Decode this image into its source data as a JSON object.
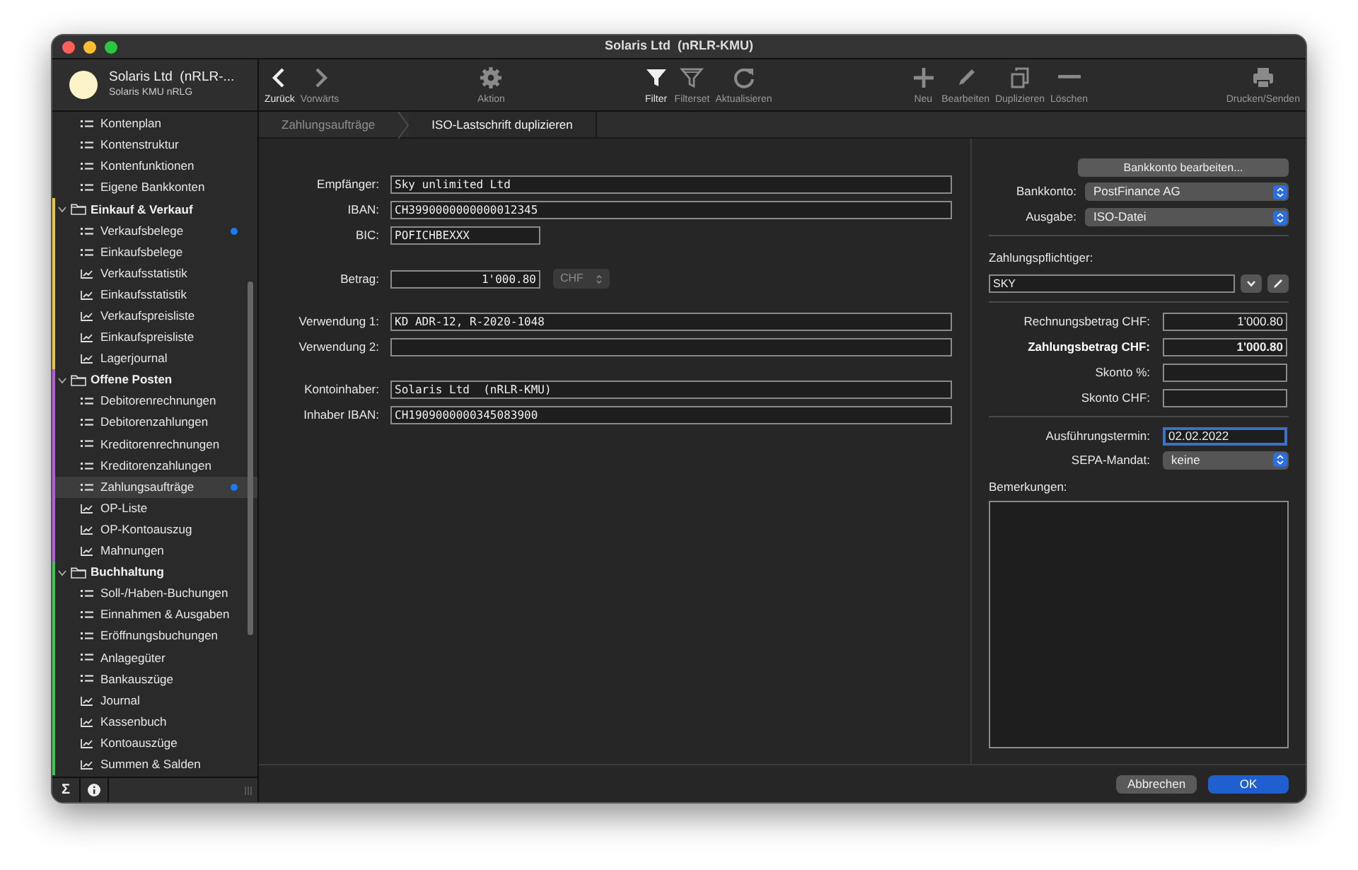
{
  "window": {
    "title": "Solaris Ltd  (nRLR-KMU)"
  },
  "sidebar": {
    "header": {
      "title": "Solaris Ltd  (nRLR-...",
      "subtitle": "Solaris KMU nRLG"
    },
    "partial_items": [
      {
        "label": "Kontenplan",
        "kind": "list",
        "selected": false,
        "unread": false
      },
      {
        "label": "Kontenstruktur",
        "kind": "list",
        "selected": false,
        "unread": false
      },
      {
        "label": "Kontenfunktionen",
        "kind": "list",
        "selected": false,
        "unread": false
      },
      {
        "label": "Eigene Bankkonten",
        "kind": "list",
        "selected": false,
        "unread": false
      }
    ],
    "groups": [
      {
        "label": "Einkauf & Verkauf",
        "color": "#e6c83a",
        "expanded": true,
        "children": [
          {
            "label": "Verkaufsbelege",
            "kind": "list",
            "selected": false,
            "unread": true
          },
          {
            "label": "Einkaufsbelege",
            "kind": "list",
            "selected": false,
            "unread": false
          },
          {
            "label": "Verkaufsstatistik",
            "kind": "report",
            "selected": false,
            "unread": false
          },
          {
            "label": "Einkaufsstatistik",
            "kind": "report",
            "selected": false,
            "unread": false
          },
          {
            "label": "Verkaufspreisliste",
            "kind": "report",
            "selected": false,
            "unread": false
          },
          {
            "label": "Einkaufspreisliste",
            "kind": "report",
            "selected": false,
            "unread": false
          },
          {
            "label": "Lagerjournal",
            "kind": "report",
            "selected": false,
            "unread": false
          }
        ]
      },
      {
        "label": "Offene Posten",
        "color": "#b45cd6",
        "expanded": true,
        "children": [
          {
            "label": "Debitorenrechnungen",
            "kind": "list",
            "selected": false,
            "unread": false
          },
          {
            "label": "Debitorenzahlungen",
            "kind": "list",
            "selected": false,
            "unread": false
          },
          {
            "label": "Kreditorenrechnungen",
            "kind": "list",
            "selected": false,
            "unread": false
          },
          {
            "label": "Kreditorenzahlungen",
            "kind": "list",
            "selected": false,
            "unread": false
          },
          {
            "label": "Zahlungsaufträge",
            "kind": "list",
            "selected": true,
            "unread": true
          },
          {
            "label": "OP-Liste",
            "kind": "report",
            "selected": false,
            "unread": false
          },
          {
            "label": "OP-Kontoauszug",
            "kind": "report",
            "selected": false,
            "unread": false
          },
          {
            "label": "Mahnungen",
            "kind": "report",
            "selected": false,
            "unread": false
          }
        ]
      },
      {
        "label": "Buchhaltung",
        "color": "#3cc84a",
        "expanded": true,
        "children": [
          {
            "label": "Soll-/Haben-Buchungen",
            "kind": "list",
            "selected": false,
            "unread": false
          },
          {
            "label": "Einnahmen & Ausgaben",
            "kind": "list",
            "selected": false,
            "unread": false
          },
          {
            "label": "Eröffnungsbuchungen",
            "kind": "list",
            "selected": false,
            "unread": false
          },
          {
            "label": "Anlagegüter",
            "kind": "list",
            "selected": false,
            "unread": false
          },
          {
            "label": "Bankauszüge",
            "kind": "list",
            "selected": false,
            "unread": false
          },
          {
            "label": "Journal",
            "kind": "report",
            "selected": false,
            "unread": false
          },
          {
            "label": "Kassenbuch",
            "kind": "report",
            "selected": false,
            "unread": false
          },
          {
            "label": "Kontoauszüge",
            "kind": "report",
            "selected": false,
            "unread": false
          },
          {
            "label": "Summen & Salden",
            "kind": "report",
            "selected": false,
            "unread": false
          }
        ]
      }
    ],
    "footer_buttons": [
      {
        "kind": "sum",
        "label": "Σ"
      },
      {
        "kind": "info"
      }
    ]
  },
  "toolbar": {
    "groups": [
      [
        {
          "label": "Zurück",
          "kind": "back",
          "disabled": false
        },
        {
          "label": "Vorwärts",
          "kind": "forward",
          "disabled": true
        }
      ],
      [
        {
          "label": "Aktion",
          "kind": "action",
          "disabled": true
        }
      ],
      [
        {
          "label": "Filter",
          "kind": "filter",
          "disabled": false
        },
        {
          "label": "Filterset",
          "kind": "filterset",
          "disabled": true
        },
        {
          "label": "Aktualisieren",
          "kind": "refresh",
          "disabled": true
        }
      ],
      [
        {
          "label": "Neu",
          "kind": "new",
          "disabled": true
        },
        {
          "label": "Bearbeiten",
          "kind": "edit",
          "disabled": true
        },
        {
          "label": "Duplizieren",
          "kind": "duplicate",
          "disabled": true
        },
        {
          "label": "Löschen",
          "kind": "delete",
          "disabled": true
        }
      ],
      [
        {
          "label": "Drucken/Senden",
          "kind": "print",
          "disabled": true
        }
      ]
    ]
  },
  "breadcrumb": [
    {
      "label": "Zahlungsaufträge",
      "selected": false
    },
    {
      "label": "ISO-Lastschrift duplizieren",
      "selected": true
    }
  ],
  "form": {
    "sections": [
      [
        {
          "label": "Empfänger:",
          "value": "Sky unlimited Ltd",
          "kind": "text"
        },
        {
          "label": "IBAN:",
          "value": "CH3990000000000012345",
          "kind": "text"
        },
        {
          "label": "BIC:",
          "value": "POFICHBEXXX",
          "kind": "short"
        }
      ],
      [
        {
          "label": "Betrag:",
          "value": "1'000.80",
          "kind": "amount",
          "currency": "CHF"
        }
      ],
      [
        {
          "label": "Verwendung 1:",
          "value": "KD ADR-12, R-2020-1048",
          "kind": "text"
        },
        {
          "label": "Verwendung 2:",
          "kind": "text"
        }
      ],
      [
        {
          "label": "Kontoinhaber:",
          "value": "Solaris Ltd  (nRLR-KMU)",
          "kind": "text"
        },
        {
          "label": "Inhaber IBAN:",
          "value": "CH1909000000345083900",
          "kind": "text"
        }
      ]
    ]
  },
  "side_panel": {
    "edit_button": "Bankkonto bearbeiten...",
    "selects": [
      {
        "label": "Bankkonto:",
        "value": "PostFinance AG"
      },
      {
        "label": "Ausgabe:",
        "value": "ISO-Datei"
      }
    ],
    "payer": {
      "label": "Zahlungspflichtiger:",
      "value": "SKY"
    },
    "amounts": [
      {
        "label": "Rechnungsbetrag CHF:",
        "value": "1'000.80",
        "bold": false
      },
      {
        "label": "Zahlungsbetrag CHF:",
        "value": "1'000.80",
        "bold": true
      },
      {
        "label": "Skonto %:",
        "bold": false
      },
      {
        "label": "Skonto CHF:",
        "bold": false
      }
    ],
    "execution_date": {
      "label": "Ausführungstermin:",
      "value": "02.02.2022",
      "focused": true
    },
    "mandate": {
      "label": "SEPA-Mandat:",
      "value": "keine"
    },
    "notes": {
      "label": "Bemerkungen:"
    }
  },
  "buttons": [
    {
      "label": "Abbrechen",
      "kind": "cancel"
    },
    {
      "label": "OK",
      "kind": "default"
    }
  ]
}
